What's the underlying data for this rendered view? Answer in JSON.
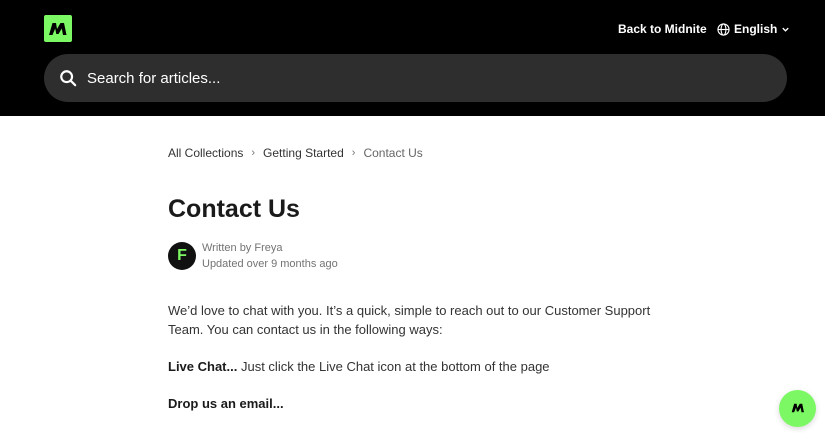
{
  "brand": {
    "accent": "#7CF864",
    "header_bg": "#000000",
    "search_bg": "#2e2e2e"
  },
  "header": {
    "logo_icon": "midnite-logo-icon",
    "back_link": "Back to Midnite",
    "language": {
      "label": "English",
      "icon": "globe-icon",
      "caret": "chevron-down-icon"
    },
    "search": {
      "placeholder": "Search for articles...",
      "value": "",
      "icon": "search-icon"
    }
  },
  "breadcrumb": {
    "items": [
      "All Collections",
      "Getting Started"
    ],
    "current": "Contact Us",
    "separator": "›"
  },
  "article": {
    "title": "Contact Us",
    "author": {
      "avatar_letter": "F",
      "written_by": "Written by Freya",
      "updated": "Updated over 9 months ago"
    },
    "intro": "We’d love to chat with you. It’s a quick, simple to reach out to our Customer Support Team. You can contact us in the following ways:",
    "live_chat_label": "Live Chat...",
    "live_chat_text": " Just click the Live Chat icon at the bottom of the page",
    "email_label": "Drop us an email..."
  },
  "chat_button": {
    "icon": "midnite-chat-icon"
  }
}
